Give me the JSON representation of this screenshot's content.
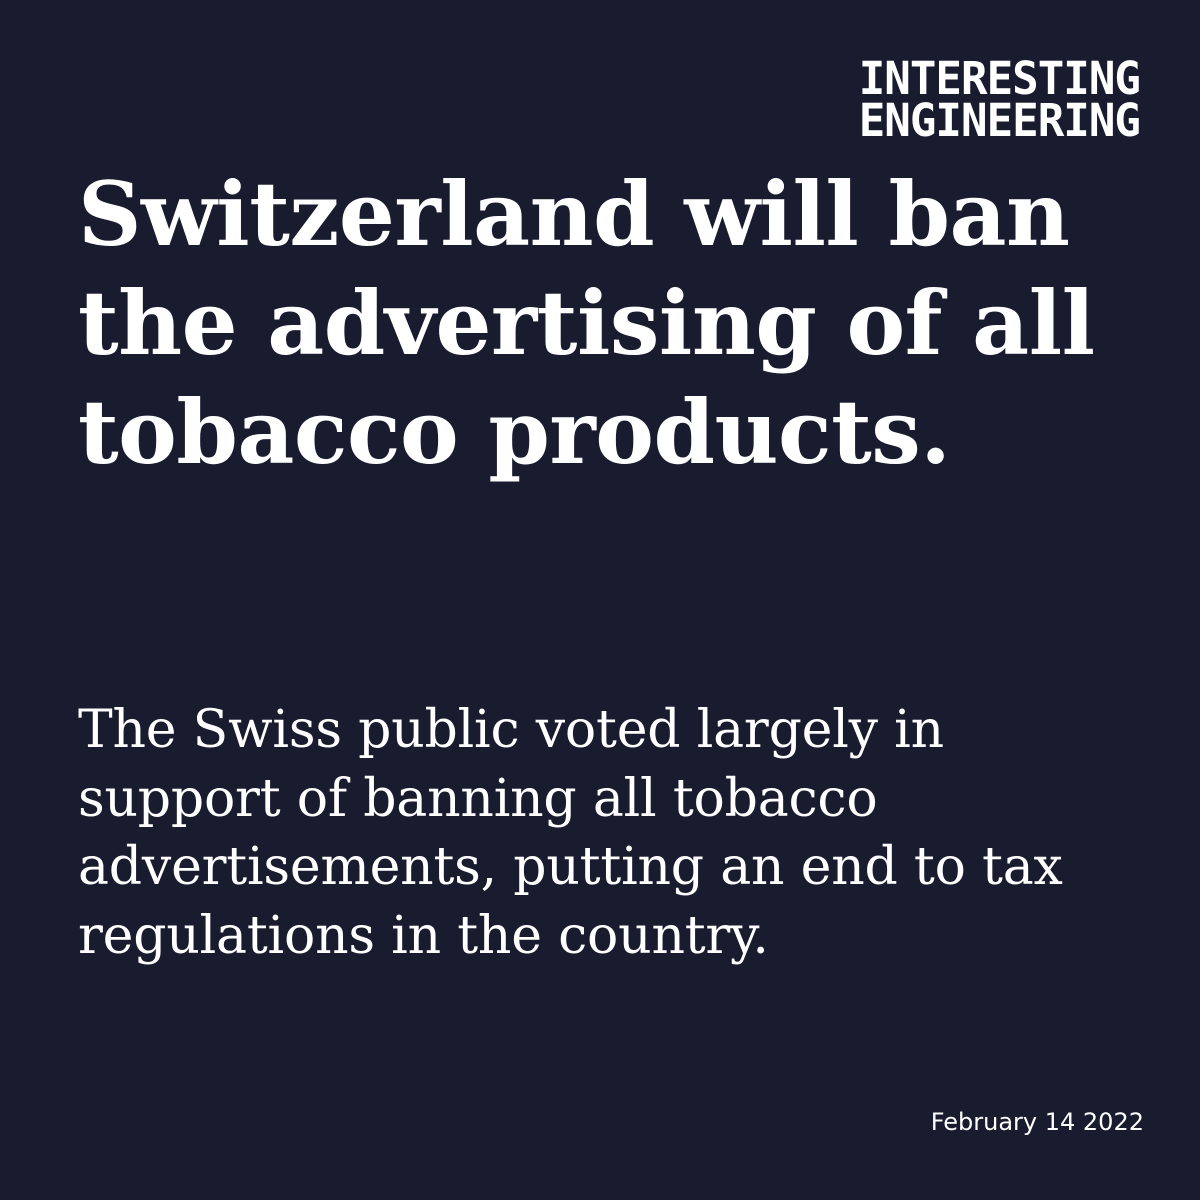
{
  "brand": {
    "line1": "INTERESTING",
    "line2": "ENGINEERING"
  },
  "article": {
    "headline": "Switzerland will ban the advertising of all tobacco products.",
    "subheadline": "The Swiss public voted largely in support of banning all tobacco advertisements, putting an end to tax regulations in the country."
  },
  "footer": {
    "date": "February 14 2022"
  },
  "colors": {
    "background": "#191b2e",
    "text": "#ffffff"
  }
}
